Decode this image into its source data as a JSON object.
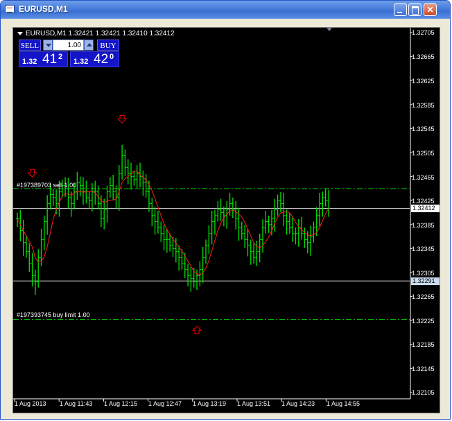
{
  "window": {
    "title": "EURUSD,M1",
    "icon": "chart-window-icon",
    "controls": [
      "minimize-icon",
      "maximize-icon",
      "close-icon"
    ]
  },
  "chart_header": {
    "symbol_line": "EURUSD,M1  1.32421 1.32421 1.32410 1.32412"
  },
  "trade_panel": {
    "sell_label": "SELL",
    "buy_label": "BUY",
    "lot_value": "1.00",
    "sell_quote": {
      "main": "1.32",
      "big": "41",
      "sup": "2"
    },
    "buy_quote": {
      "main": "1.32",
      "big": "42",
      "sup": "0"
    }
  },
  "orders": {
    "sell_order": "#197389703 sell 1.00",
    "buy_limit": "#197393745 buy limit 1.00"
  },
  "price_axis": {
    "labels": [
      "1.32705",
      "1.32665",
      "1.32625",
      "1.32585",
      "1.32545",
      "1.32505",
      "1.32465",
      "1.32425",
      "1.32385",
      "1.32345",
      "1.32305",
      "1.32265",
      "1.32225",
      "1.32185",
      "1.32145",
      "1.32105"
    ],
    "bid_tag": "1.32412",
    "low_tag": "1.32291"
  },
  "time_axis": {
    "labels": [
      "1 Aug 2013",
      "1 Aug 11:43",
      "1 Aug 12:15",
      "1 Aug 12:47",
      "1 Aug 13:19",
      "1 Aug 13:51",
      "1 Aug 14:23",
      "1 Aug 14:55"
    ]
  },
  "colors": {
    "background": "#000000",
    "bars": "#00e600",
    "moving_average": "#ff2020",
    "order_lines": "#00c000",
    "bid_line": "#c0c0c0",
    "arrows": "#ff0000",
    "panel": "#1414c8"
  },
  "chart_data": {
    "type": "ohlc",
    "symbol": "EURUSD",
    "timeframe": "M1",
    "ylim": [
      1.32105,
      1.32705
    ],
    "time_range": [
      "1 Aug 2013",
      "1 Aug 14:55"
    ],
    "levels": {
      "sell_order": 1.32445,
      "buy_limit": 1.32227,
      "bid": 1.32412,
      "low_line": 1.32291
    },
    "markers": [
      {
        "type": "sell-arrow",
        "time_index": 35,
        "price": 1.3256
      },
      {
        "type": "sell-arrow",
        "time_index": 5,
        "price": 1.3247
      },
      {
        "type": "buy-arrow",
        "time_index": 60,
        "price": 1.3221
      }
    ],
    "close": [
      1.32395,
      1.32375,
      1.32355,
      1.3234,
      1.3232,
      1.323,
      1.3229,
      1.3233,
      1.3236,
      1.3239,
      1.3242,
      1.32435,
      1.3243,
      1.3242,
      1.3244,
      1.3245,
      1.32445,
      1.3243,
      1.3242,
      1.3244,
      1.32455,
      1.3245,
      1.3244,
      1.3243,
      1.32425,
      1.3244,
      1.3244,
      1.3242,
      1.32395,
      1.3241,
      1.3244,
      1.3245,
      1.3244,
      1.3243,
      1.3247,
      1.325,
      1.3248,
      1.3247,
      1.32465,
      1.3246,
      1.3247,
      1.32465,
      1.32455,
      1.3244,
      1.3242,
      1.324,
      1.3239,
      1.3238,
      1.3237,
      1.3236,
      1.3236,
      1.3235,
      1.32345,
      1.3234,
      1.3233,
      1.3232,
      1.3231,
      1.323,
      1.32295,
      1.3229,
      1.323,
      1.3231,
      1.3233,
      1.3235,
      1.3237,
      1.3239,
      1.324,
      1.3241,
      1.32405,
      1.324,
      1.3241,
      1.3242,
      1.3241,
      1.32395,
      1.3238,
      1.3237,
      1.3236,
      1.3235,
      1.3234,
      1.3233,
      1.3234,
      1.3236,
      1.3238,
      1.3239,
      1.32385,
      1.32395,
      1.3241,
      1.32425,
      1.3242,
      1.324,
      1.3239,
      1.3238,
      1.3237,
      1.3237,
      1.3238,
      1.3237,
      1.3236,
      1.32355,
      1.32365,
      1.3238,
      1.324,
      1.3242,
      1.3243,
      1.32425,
      1.32412
    ]
  }
}
